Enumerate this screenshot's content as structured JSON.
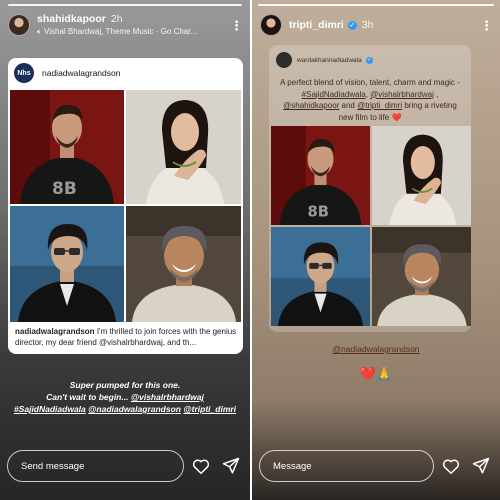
{
  "left_story": {
    "username": "shahidkapoor",
    "time": "2h",
    "music": "Vishal Bhardwaj, Theme Music · Go Char...",
    "post": {
      "logo_text": "Nhs",
      "username": "nadiadwalagrandson",
      "caption_user": "nadiadwalagrandson",
      "caption_text": "I'm thrilled to join forces with the genius director, my dear friend @vishalrbhardwaj, and th..."
    },
    "text": {
      "line1": "Super pumped for this one.",
      "line2_prefix": "Can't wait to begin... ",
      "tag1": "@vishalrbhardwaj",
      "tag2": "#SajidNadiadwala",
      "tag3": "@nadiadwalagrandson",
      "tag4": "@tripti_dimri"
    },
    "message_placeholder": "Send message"
  },
  "right_story": {
    "username": "tripti_dimri",
    "time": "3h",
    "repost": {
      "username": "wardakhannadiadwala",
      "text_start": "A perfect blend of vision, talent, charm and magic - ",
      "tag1": "#SajidNadiadwala",
      "sep1": ", ",
      "tag2": "@vishalrbhardwaj",
      "sep2": " , ",
      "tag3": "@shahidkapoor",
      "sep3": " and ",
      "tag4": "@tripti_dimri",
      "text_end": " bring a riveting new film to life ❤️"
    },
    "mention": "@nadiadwalagrandson",
    "reaction": "❤️🙏",
    "message_placeholder": "Message"
  },
  "colors": {
    "instagram_verified": "#3897f0",
    "brand_logo": "#1b2f5c"
  }
}
